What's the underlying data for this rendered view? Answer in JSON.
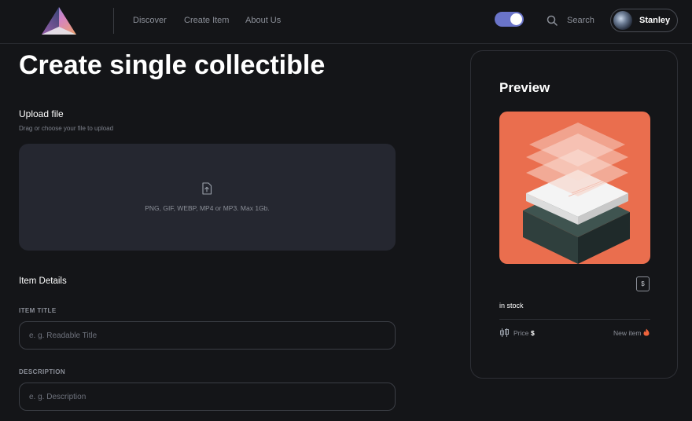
{
  "header": {
    "nav": [
      "Discover",
      "Create Item",
      "About Us"
    ],
    "search_label": "Search",
    "user_name": "Stanley",
    "theme_toggle_on": true
  },
  "main": {
    "title": "Create single collectible",
    "upload": {
      "title": "Upload file",
      "subtitle": "Drag or choose your file to upload",
      "formats": "PNG, GIF, WEBP, MP4 or MP3. Max 1Gb."
    },
    "details_heading": "Item Details",
    "fields": [
      {
        "label": "ITEM TITLE",
        "placeholder": "e. g. Readable Title"
      },
      {
        "label": "DESCRIPTION",
        "placeholder": "e. g. Description"
      }
    ]
  },
  "preview": {
    "title": "Preview",
    "badge": "$",
    "stock": "in stock",
    "price_label": "Price",
    "price_value": "$",
    "new_item_label": "New item"
  },
  "colors": {
    "background": "#141518",
    "upload_zone": "#252730",
    "toggle": "#6a74c9",
    "preview_bg": "#ea6e4e",
    "accent_fire": "#f0643c"
  },
  "icons": [
    "logo-icon",
    "search-icon",
    "upload-file-icon",
    "dollar-badge-icon",
    "bid-icon",
    "fire-icon"
  ]
}
